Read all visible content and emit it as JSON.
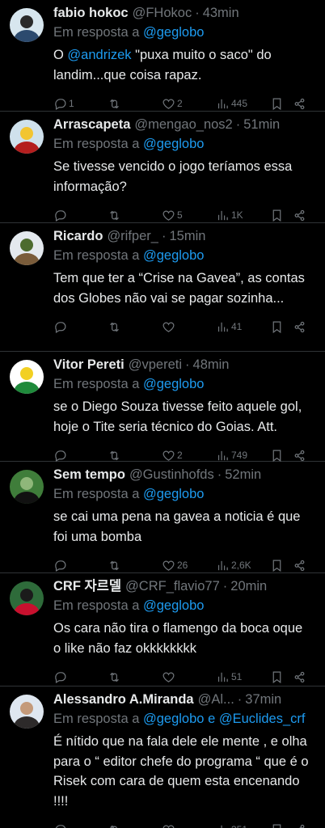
{
  "reply_prefix": "Em resposta a",
  "tweets": [
    {
      "name": "fabio hokoc",
      "handle": "@FHokoc",
      "sep": "·",
      "time": "43min",
      "reply_to": "@geglobo",
      "text_parts": [
        "O ",
        "@andrizek",
        " \"puxa muito o saco\" do landim...que coisa rapaz."
      ],
      "replies": "1",
      "retweets": "",
      "likes": "2",
      "views": "445",
      "avatar_colors": [
        "#d7e6ee",
        "#2c4a6e",
        "#2a2a2a"
      ]
    },
    {
      "name": "Arrascapeta",
      "handle": "@mengao_nos2",
      "sep": "·",
      "time": "51min",
      "reply_to": "@geglobo",
      "text": "Se tivesse vencido o jogo teríamos essa informação?",
      "replies": "",
      "retweets": "",
      "likes": "5",
      "views": "1K",
      "avatar_colors": [
        "#cfe1ec",
        "#b41e1e",
        "#f2c531"
      ]
    },
    {
      "name": "Ricardo",
      "handle": "@rifper_",
      "sep": "·",
      "time": "15min",
      "reply_to": "@geglobo",
      "text": "Tem que ter a “Crise na Gavea”, as contas dos Globes não vai se pagar sozinha...",
      "replies": "",
      "retweets": "",
      "likes": "",
      "views": "41",
      "avatar_colors": [
        "#e4e9ee",
        "#7a5c3a",
        "#4d6b2e"
      ]
    },
    {
      "name": "Vitor Pereti",
      "handle": "@vpereti",
      "sep": "·",
      "time": "48min",
      "reply_to": "@geglobo",
      "text": "se o Diego Souza tivesse feito aquele gol, hoje o Tite seria técnico do Goias. Att.",
      "replies": "",
      "retweets": "",
      "likes": "2",
      "views": "749",
      "avatar_colors": [
        "#ffffff",
        "#1f8a3b",
        "#f2d022"
      ]
    },
    {
      "name": "Sem tempo",
      "handle": "@Gustinhofds",
      "sep": "·",
      "time": "52min",
      "reply_to": "@geglobo",
      "text": "se cai uma pena na gavea a noticia é que foi uma bomba",
      "replies": "",
      "retweets": "",
      "likes": "26",
      "views": "2,6K",
      "avatar_colors": [
        "#3f7d3a",
        "#111111",
        "#8fb77a"
      ]
    },
    {
      "name": "CRF 자르델",
      "handle": "@CRF_flavio77",
      "sep": "·",
      "time": "20min",
      "reply_to": "@geglobo",
      "text": "Os cara não tira o flamengo da boca oque o like não faz okkkkkkkk",
      "replies": "",
      "retweets": "",
      "likes": "",
      "views": "51",
      "avatar_colors": [
        "#2e6b3a",
        "#c8102e",
        "#1b1b1b"
      ]
    },
    {
      "name": "Alessandro A.Miranda",
      "handle": "@Al...",
      "sep": "·",
      "time": "37min",
      "reply_to": "@geglobo",
      "reply_join": "e",
      "reply_to2": "@Euclides_crf",
      "text": "É nítido que na fala dele ele mente , e olha para o “ editor chefe do programa “ que é o Risek  com cara de quem esta encenando !!!!",
      "replies": "",
      "retweets": "",
      "likes": "",
      "views": "351",
      "avatar_colors": [
        "#dfe7f0",
        "#2d2a2a",
        "#c49a7a"
      ]
    }
  ],
  "icons": {
    "reply": "reply-icon",
    "retweet": "retweet-icon",
    "like": "heart-icon",
    "views": "views-icon",
    "bookmark": "bookmark-icon",
    "share": "share-icon"
  },
  "colors": {
    "background": "#000000",
    "text": "#e7e9ea",
    "muted": "#71767b",
    "link": "#1d9bf0",
    "divider": "#2f3336"
  }
}
